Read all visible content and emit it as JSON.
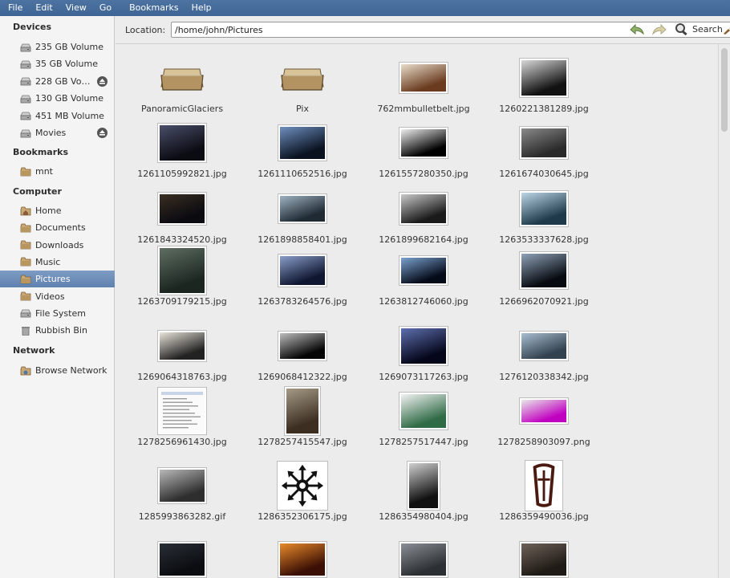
{
  "menu": [
    "File",
    "Edit",
    "View",
    "Go",
    "Bookmarks",
    "Help"
  ],
  "sidebar": {
    "devices_title": "Devices",
    "devices": [
      {
        "label": "235 GB Volume",
        "eject": false
      },
      {
        "label": "35 GB Volume",
        "eject": false
      },
      {
        "label": "228 GB Vo…",
        "eject": true
      },
      {
        "label": "130 GB Volume",
        "eject": false
      },
      {
        "label": "451 MB Volume",
        "eject": false
      },
      {
        "label": "Movies",
        "eject": true
      }
    ],
    "bookmarks_title": "Bookmarks",
    "bookmarks": [
      {
        "label": "mnt"
      }
    ],
    "computer_title": "Computer",
    "computer": [
      {
        "label": "Home",
        "icon": "home-icon"
      },
      {
        "label": "Documents",
        "icon": "folder-icon"
      },
      {
        "label": "Downloads",
        "icon": "folder-icon"
      },
      {
        "label": "Music",
        "icon": "folder-icon"
      },
      {
        "label": "Pictures",
        "icon": "folder-icon",
        "selected": true
      },
      {
        "label": "Videos",
        "icon": "folder-icon"
      },
      {
        "label": "File System",
        "icon": "drive-icon"
      },
      {
        "label": "Rubbish Bin",
        "icon": "trash-icon"
      }
    ],
    "network_title": "Network",
    "network": [
      {
        "label": "Browse Network"
      }
    ]
  },
  "location": {
    "label": "Location:",
    "path": "/home/john/Pictures",
    "search_label": "Search"
  },
  "files": [
    {
      "name": "PanoramicGlaciers",
      "kind": "folder"
    },
    {
      "name": "Pix",
      "kind": "folder"
    },
    {
      "name": "762mmbulletbelt.jpg",
      "kind": "image",
      "colors": [
        "#e8dccb",
        "#6a3b1e"
      ]
    },
    {
      "name": "1260221381289.jpg",
      "kind": "image",
      "colors": [
        "#d8d8d8",
        "#111111"
      ]
    },
    {
      "name": "1261105992821.jpg",
      "kind": "image",
      "colors": [
        "#4a4f6a",
        "#0b0b12"
      ]
    },
    {
      "name": "1261110652516.jpg",
      "kind": "image",
      "colors": [
        "#6e8fbf",
        "#0a1220"
      ]
    },
    {
      "name": "1261557280350.jpg",
      "kind": "image",
      "colors": [
        "#eeeeee",
        "#000000"
      ]
    },
    {
      "name": "1261674030645.jpg",
      "kind": "image",
      "colors": [
        "#8a8a8a",
        "#2a2a2a"
      ]
    },
    {
      "name": "1261843324520.jpg",
      "kind": "image",
      "colors": [
        "#3a2f22",
        "#0a0a10"
      ]
    },
    {
      "name": "1261898858401.jpg",
      "kind": "image",
      "colors": [
        "#9fb2c2",
        "#1f2a33"
      ]
    },
    {
      "name": "1261899682164.jpg",
      "kind": "image",
      "colors": [
        "#c9c9c9",
        "#1a1a1a"
      ]
    },
    {
      "name": "1263533337628.jpg",
      "kind": "image",
      "colors": [
        "#bcd6e6",
        "#1e3a4a"
      ]
    },
    {
      "name": "1263709179215.jpg",
      "kind": "image",
      "colors": [
        "#5f6e62",
        "#1b2620"
      ]
    },
    {
      "name": "1263783264576.jpg",
      "kind": "image",
      "colors": [
        "#8a9ec9",
        "#0f1630"
      ]
    },
    {
      "name": "1263812746060.jpg",
      "kind": "image",
      "colors": [
        "#7aa2cf",
        "#050a18"
      ]
    },
    {
      "name": "1266962070921.jpg",
      "kind": "image",
      "colors": [
        "#8fa3b8",
        "#070a10"
      ]
    },
    {
      "name": "1269064318763.jpg",
      "kind": "image",
      "colors": [
        "#e9e4da",
        "#222222"
      ]
    },
    {
      "name": "1269068412322.jpg",
      "kind": "image",
      "colors": [
        "#bdbdbd",
        "#050505"
      ]
    },
    {
      "name": "1269073117263.jpg",
      "kind": "image",
      "colors": [
        "#5d6fae",
        "#05061a"
      ]
    },
    {
      "name": "1276120338342.jpg",
      "kind": "image",
      "colors": [
        "#a8bfd2",
        "#33424f"
      ]
    },
    {
      "name": "1278256961430.jpg",
      "kind": "doc"
    },
    {
      "name": "1278257415547.jpg",
      "kind": "image",
      "colors": [
        "#a59a86",
        "#3c2f22"
      ]
    },
    {
      "name": "1278257517447.jpg",
      "kind": "image",
      "colors": [
        "#f2f2f2",
        "#2f6b46"
      ]
    },
    {
      "name": "1278258903097.png",
      "kind": "image",
      "colors": [
        "#e8e8e8",
        "#c000c0"
      ]
    },
    {
      "name": "1285993863282.gif",
      "kind": "image",
      "colors": [
        "#b9b9b9",
        "#2e2e2e"
      ]
    },
    {
      "name": "1286352306175.jpg",
      "kind": "chaos"
    },
    {
      "name": "1286354980404.jpg",
      "kind": "image",
      "colors": [
        "#cfcfcf",
        "#111111"
      ]
    },
    {
      "name": "1286359490036.jpg",
      "kind": "oblivion"
    },
    {
      "name": "",
      "kind": "image",
      "colors": [
        "#2a2f36",
        "#0a0c10"
      ]
    },
    {
      "name": "",
      "kind": "image",
      "colors": [
        "#e88a2a",
        "#3a0f05"
      ]
    },
    {
      "name": "",
      "kind": "image",
      "colors": [
        "#8a8f95",
        "#2c2f33"
      ]
    },
    {
      "name": "",
      "kind": "image",
      "colors": [
        "#6e6258",
        "#1f1a16"
      ]
    }
  ]
}
